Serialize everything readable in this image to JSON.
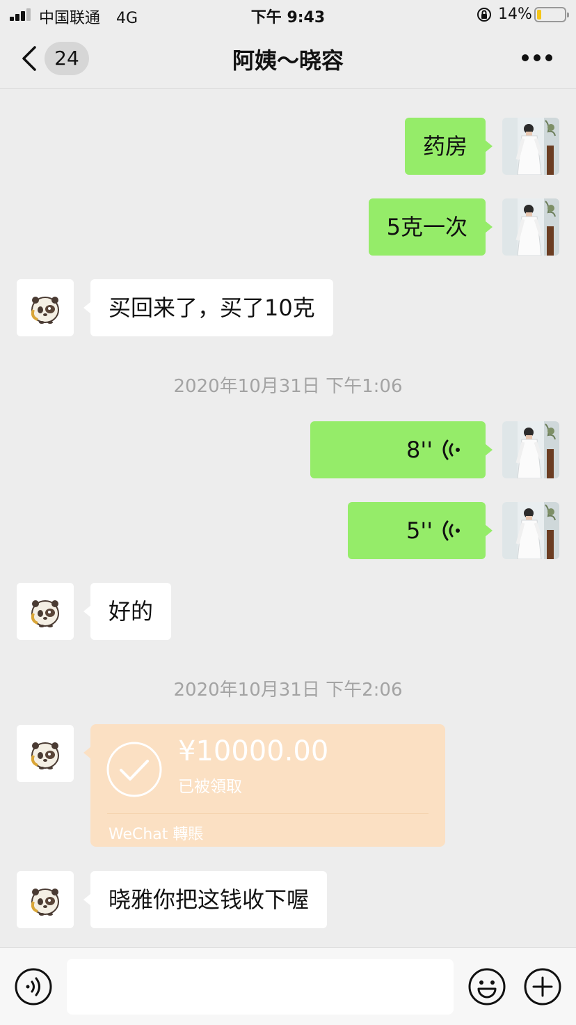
{
  "status_bar": {
    "carrier": "中国联通",
    "network": "4G",
    "time": "下午 9:43",
    "battery": "14%"
  },
  "nav": {
    "unread_count": "24",
    "title": "阿姨～晓容"
  },
  "messages": {
    "m1": "药房",
    "m2": "5克一次",
    "m3": "买回来了，买了10克",
    "ts1": "2020年10月31日 下午1:06",
    "v1": "8''",
    "v2": "5''",
    "m4": "好的",
    "ts2": "2020年10月31日 下午2:06",
    "m5": "晓雅你把这钱收下喔"
  },
  "transfer": {
    "amount": "¥10000.00",
    "status": "已被領取",
    "brand": "WeChat 轉賬"
  },
  "input": {
    "placeholder": ""
  },
  "icons": {
    "back": "chevron-left-icon",
    "more": "more-icon",
    "voice": "voice-wave-icon",
    "check": "check-circle-icon",
    "emoji": "emoji-icon",
    "add": "plus-circle-icon"
  },
  "colors": {
    "self_bubble": "#95ec69",
    "other_bubble": "#ffffff",
    "transfer_card": "#fbe0c3",
    "background": "#ededed"
  }
}
